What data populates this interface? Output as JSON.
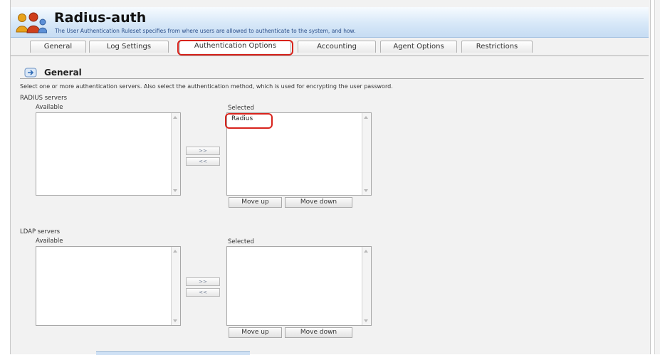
{
  "header": {
    "title": "Radius-auth",
    "subtitle": "The User Authentication Ruleset specifies from where users are allowed to authenticate to the system, and how."
  },
  "tabs": [
    {
      "label": "General"
    },
    {
      "label": "Log Settings"
    },
    {
      "label": "Authentication Options",
      "selected": true
    },
    {
      "label": "Accounting"
    },
    {
      "label": "Agent Options"
    },
    {
      "label": "Restrictions"
    }
  ],
  "section": {
    "title": "General",
    "description": "Select one or more authentication servers. Also select the authentication method, which is used for encrypting the user password."
  },
  "radius": {
    "label": "RADIUS servers",
    "available_label": "Available",
    "selected_label": "Selected",
    "selected_items": [
      "Radius"
    ],
    "add_label": ">>",
    "remove_label": "<<",
    "move_up_label": "Move up",
    "move_down_label": "Move down"
  },
  "ldap": {
    "label": "LDAP servers",
    "available_label": "Available",
    "selected_label": "Selected",
    "add_label": ">>",
    "remove_label": "<<",
    "move_up_label": "Move up",
    "move_down_label": "Move down"
  },
  "colors": {
    "highlight": "#d8231c",
    "header_blue": "#c6dcf3"
  },
  "icons": [
    "users-icon",
    "section-arrow-icon"
  ]
}
